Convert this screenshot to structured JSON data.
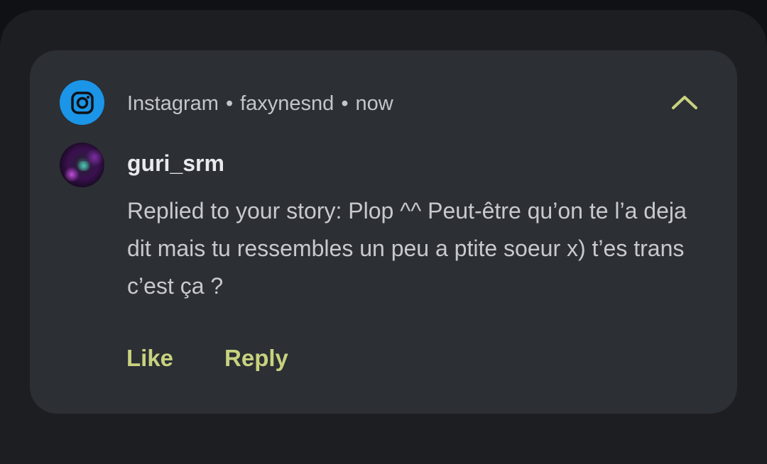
{
  "notification": {
    "app_name": "Instagram",
    "account": "faxynesnd",
    "time": "now",
    "app_icon": "instagram-icon",
    "collapse_icon": "chevron-up-icon",
    "sender": "guri_srm",
    "message": "Replied to your story: Plop ^^ Peut-être qu’on te l’a deja dit mais tu ressembles un peu a ptite soeur x) t’es trans c’est ça ?",
    "actions": {
      "like_label": "Like",
      "reply_label": "Reply"
    }
  },
  "colors": {
    "background": "#0f1114",
    "panel": "#1c1e21",
    "card": "#2c2f34",
    "instagram_blue": "#1a95e8",
    "accent": "#c8d27e"
  }
}
